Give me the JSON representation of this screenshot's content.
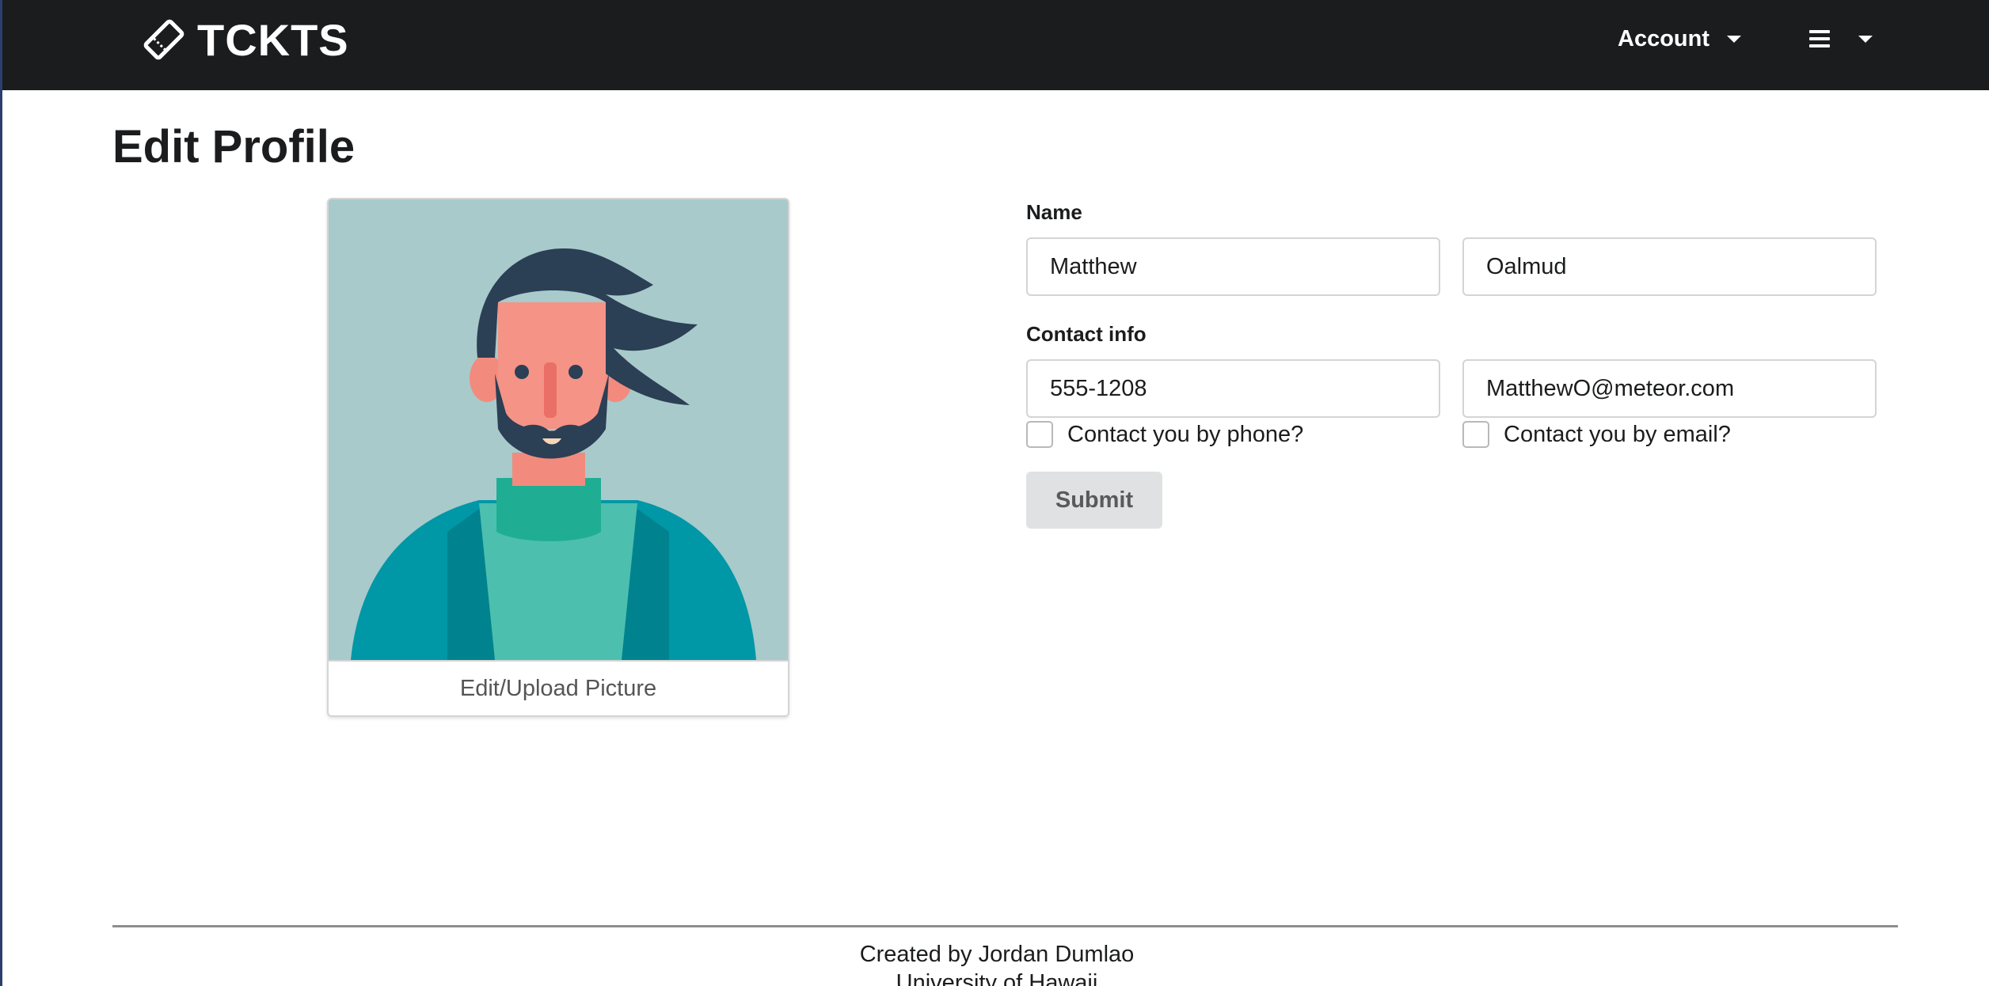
{
  "navbar": {
    "brand": "TCKTS",
    "brand_icon": "ticket-icon",
    "account_label": "Account",
    "menu_icon": "hamburger-icon"
  },
  "page": {
    "title": "Edit Profile"
  },
  "profile_card": {
    "image": "avatar-illustration-bearded-man",
    "action_label": "Edit/Upload Picture"
  },
  "form": {
    "name_label": "Name",
    "first_name": "Matthew",
    "last_name": "Oalmud",
    "contact_label": "Contact info",
    "phone": "555-1208",
    "email": "MatthewO@meteor.com",
    "phone_check_label": "Contact you by phone?",
    "email_check_label": "Contact you by email?",
    "submit_label": "Submit"
  },
  "footer": {
    "line1": "Created by Jordan Dumlao",
    "line2": "University of Hawaii"
  },
  "colors": {
    "navbar_bg": "#1b1c1d",
    "avatar_bg": "#a8cacb",
    "button_bg": "#e0e1e2"
  }
}
